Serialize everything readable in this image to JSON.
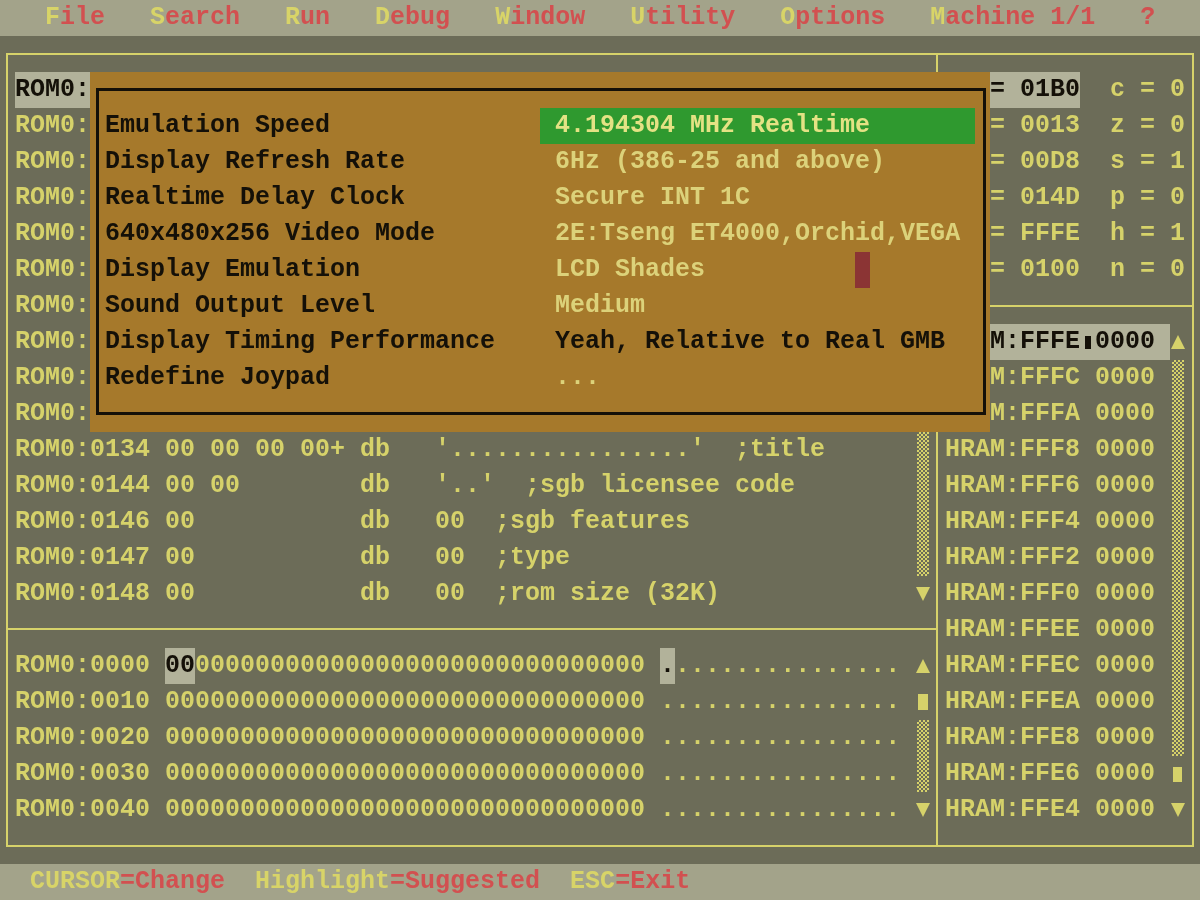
{
  "menu_bar": [
    {
      "label": "**F**ile"
    },
    {
      "label": "**S**earch"
    },
    {
      "label": "**R**un"
    },
    {
      "label": "**D**ebug"
    },
    {
      "label": "**W**indow"
    },
    {
      "label": "**U**tility"
    },
    {
      "label": "**O**ptions"
    },
    {
      "label": "**M**achine 1/1"
    },
    {
      "label": "?"
    }
  ],
  "disassembly": {
    "lines": [
      {
        "address": "ROM0:",
        "selected": true
      },
      {
        "address": "ROM0:",
        "selected": false
      },
      {
        "address": "ROM0:",
        "selected": false
      },
      {
        "address": "ROM0:",
        "selected": false
      },
      {
        "address": "ROM0:",
        "selected": false
      },
      {
        "address": "ROM0:",
        "selected": false
      },
      {
        "address": "ROM0:",
        "selected": false
      },
      {
        "address": "ROM0:",
        "selected": false
      },
      {
        "address": "ROM0:",
        "selected": false
      },
      {
        "address": "ROM0:",
        "selected": false
      },
      {
        "address": "ROM0:0134",
        "bytes": "00 00 00 00+",
        "mnemonic": "db",
        "operand": "'................'",
        "comment": ";title",
        "selected": false
      },
      {
        "address": "ROM0:0144",
        "bytes": "00 00",
        "mnemonic": "db",
        "operand": "'..'",
        "comment": ";sgb licensee code",
        "selected": false
      },
      {
        "address": "ROM0:0146",
        "bytes": "00",
        "mnemonic": "db",
        "operand": "00",
        "comment": ";sgb features",
        "selected": false
      },
      {
        "address": "ROM0:0147",
        "bytes": "00",
        "mnemonic": "db",
        "operand": "00",
        "comment": ";type",
        "selected": false
      },
      {
        "address": "ROM0:0148",
        "bytes": "00",
        "mnemonic": "db",
        "operand": "00",
        "comment": ";rom size (32K)",
        "selected": false
      }
    ]
  },
  "hex_dump": {
    "lines": [
      {
        "address": "ROM0:0000",
        "cursor_byte": "00",
        "bytes": "000000000000000000000000000000",
        "cursor_char": ".",
        "ascii": "..............."
      },
      {
        "address": "ROM0:0010",
        "bytes": "00000000000000000000000000000000",
        "ascii": "................"
      },
      {
        "address": "ROM0:0020",
        "bytes": "00000000000000000000000000000000",
        "ascii": "................"
      },
      {
        "address": "ROM0:0030",
        "bytes": "00000000000000000000000000000000",
        "ascii": "................"
      },
      {
        "address": "ROM0:0040",
        "bytes": "00000000000000000000000000000000",
        "ascii": "................"
      }
    ]
  },
  "registers": [
    {
      "value": "= 01B0",
      "flag": "c = 0",
      "selected": true
    },
    {
      "value": "= 0013",
      "flag": "z = 0",
      "selected": false
    },
    {
      "value": "= 00D8",
      "flag": "s = 1",
      "selected": false
    },
    {
      "value": "= 014D",
      "flag": "p = 0",
      "selected": false
    },
    {
      "value": "= FFFE",
      "flag": "h = 1",
      "selected": false
    },
    {
      "value": "= 0100",
      "flag": "n = 0",
      "selected": false
    }
  ],
  "stack": [
    {
      "address": "M:FFFE",
      "value": "0000",
      "selected": true
    },
    {
      "address": "M:FFFC",
      "value": "0000",
      "selected": false
    },
    {
      "address": "M:FFFA",
      "value": "0000",
      "selected": false
    },
    {
      "address": "HRAM:FFF8",
      "value": "0000",
      "selected": false
    },
    {
      "address": "HRAM:FFF6",
      "value": "0000",
      "selected": false
    },
    {
      "address": "HRAM:FFF4",
      "value": "0000",
      "selected": false
    },
    {
      "address": "HRAM:FFF2",
      "value": "0000",
      "selected": false
    },
    {
      "address": "HRAM:FFF0",
      "value": "0000",
      "selected": false
    },
    {
      "address": "HRAM:FFEE",
      "value": "0000",
      "selected": false
    },
    {
      "address": "HRAM:FFEC",
      "value": "0000",
      "selected": false
    },
    {
      "address": "HRAM:FFEA",
      "value": "0000",
      "selected": false
    },
    {
      "address": "HRAM:FFE8",
      "value": "0000",
      "selected": false
    },
    {
      "address": "HRAM:FFE6",
      "value": "0000",
      "selected": false
    },
    {
      "address": "HRAM:FFE4",
      "value": "0000",
      "selected": false
    }
  ],
  "dialog": {
    "options": [
      {
        "label": "Emulation Speed",
        "value": "4.194304 MHz Realtime",
        "selected": true,
        "suggested": true
      },
      {
        "label": "Display Refresh Rate",
        "value": "6Hz (386-25 and above)",
        "selected": false,
        "suggested": true
      },
      {
        "label": "Realtime Delay Clock",
        "value": "Secure INT 1C",
        "selected": false,
        "suggested": true
      },
      {
        "label": "640x480x256 Video Mode",
        "value": "2E:Tseng ET4000,Orchid,VEGA",
        "selected": false,
        "suggested": true
      },
      {
        "label": "Display Emulation",
        "value": "LCD Shades",
        "selected": false,
        "suggested": true,
        "color": "#8b3434"
      },
      {
        "label": "Sound Output Level",
        "value": "Medium",
        "selected": false,
        "suggested": true
      },
      {
        "label": "Display Timing Performance",
        "value": "Yeah, Relative to Real GMB",
        "selected": false,
        "suggested": false
      },
      {
        "label": "Redefine Joypad",
        "value": "...",
        "selected": false,
        "suggested": true
      }
    ]
  },
  "status_bar": [
    {
      "text": "**CURSOR**=Change"
    },
    {
      "text": "**Highlight**=Suggested"
    },
    {
      "text": "**ESC**=Exit"
    }
  ]
}
